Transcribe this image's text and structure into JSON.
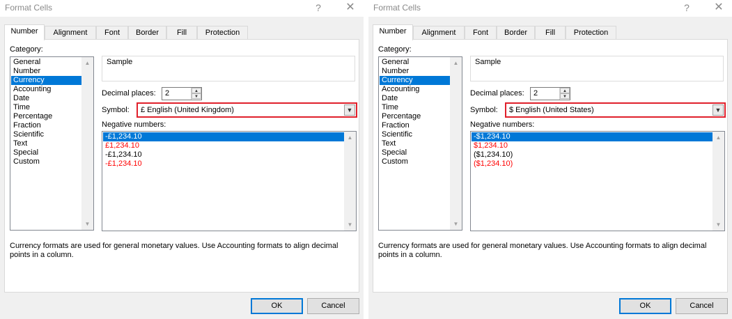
{
  "dialogs": [
    {
      "title": "Format Cells",
      "help_icon": "?",
      "close_icon": "✕",
      "tabs": [
        "Number",
        "Alignment",
        "Font",
        "Border",
        "Fill",
        "Protection"
      ],
      "active_tab": "Number",
      "category_label": "Category:",
      "categories": [
        "General",
        "Number",
        "Currency",
        "Accounting",
        "Date",
        "Time",
        "Percentage",
        "Fraction",
        "Scientific",
        "Text",
        "Special",
        "Custom"
      ],
      "selected_category": "Currency",
      "sample_label": "Sample",
      "decimal_label": "Decimal places:",
      "decimal_value": "2",
      "symbol_label": "Symbol:",
      "symbol_value": "£ English (United Kingdom)",
      "negative_label": "Negative numbers:",
      "negative_numbers": [
        {
          "text": "-£1,234.10",
          "style": "selected"
        },
        {
          "text": "£1,234.10",
          "style": "red"
        },
        {
          "text": "-£1,234.10",
          "style": "normal"
        },
        {
          "text": "-£1,234.10",
          "style": "red"
        }
      ],
      "description": "Currency formats are used for general monetary values.  Use Accounting formats to align decimal points in a column.",
      "ok_label": "OK",
      "cancel_label": "Cancel"
    },
    {
      "title": "Format Cells",
      "help_icon": "?",
      "close_icon": "✕",
      "tabs": [
        "Number",
        "Alignment",
        "Font",
        "Border",
        "Fill",
        "Protection"
      ],
      "active_tab": "Number",
      "category_label": "Category:",
      "categories": [
        "General",
        "Number",
        "Currency",
        "Accounting",
        "Date",
        "Time",
        "Percentage",
        "Fraction",
        "Scientific",
        "Text",
        "Special",
        "Custom"
      ],
      "selected_category": "Currency",
      "sample_label": "Sample",
      "decimal_label": "Decimal places:",
      "decimal_value": "2",
      "symbol_label": "Symbol:",
      "symbol_value": "$ English (United States)",
      "negative_label": "Negative numbers:",
      "negative_numbers": [
        {
          "text": "-$1,234.10",
          "style": "selected"
        },
        {
          "text": "$1,234.10",
          "style": "red"
        },
        {
          "text": "($1,234.10)",
          "style": "normal"
        },
        {
          "text": "($1,234.10)",
          "style": "red"
        }
      ],
      "description": "Currency formats are used for general monetary values.  Use Accounting formats to align decimal points in a column.",
      "ok_label": "OK",
      "cancel_label": "Cancel"
    }
  ],
  "colors": {
    "selection": "#0078d7",
    "highlight_border": "#e0202b",
    "negative_red": "#ff0000"
  }
}
